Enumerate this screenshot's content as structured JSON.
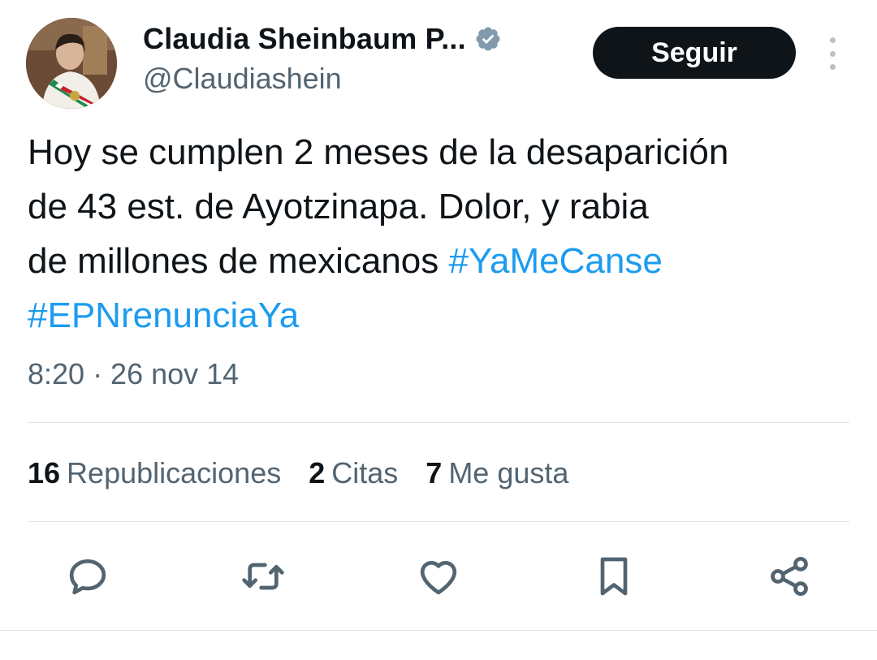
{
  "author": {
    "display_name": "Claudia Sheinbaum P...",
    "handle": "@Claudiashein",
    "verified_icon": "verified-badge-icon"
  },
  "follow_label": "Seguir",
  "tweet": {
    "text_lines": [
      "Hoy se cumplen 2 meses de la desaparición",
      "de 43 est. de Ayotzinapa. Dolor, y rabia",
      "de millones de mexicanos "
    ],
    "hashtags": [
      "#YaMeCanse",
      "#EPNrenunciaYa"
    ],
    "timestamp": "8:20 · 26 nov 14"
  },
  "stats": [
    {
      "count": "16",
      "label": "Republicaciones"
    },
    {
      "count": "2",
      "label": "Citas"
    },
    {
      "count": "7",
      "label": "Me gusta"
    }
  ],
  "actions": [
    "reply-icon",
    "retweet-icon",
    "like-icon",
    "bookmark-icon",
    "share-icon"
  ],
  "colors": {
    "text": "#0f1419",
    "secondary": "#536471",
    "link": "#1d9bf0",
    "button": "#0f1419",
    "divider": "#e1e6ea"
  }
}
